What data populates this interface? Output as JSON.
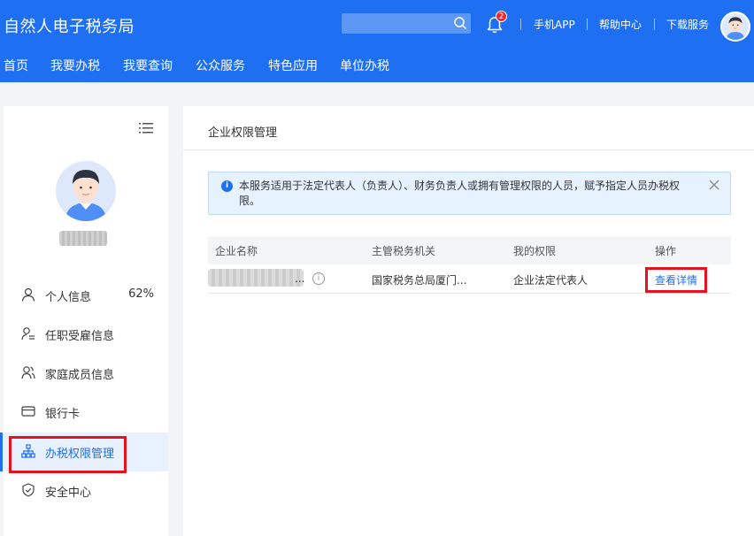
{
  "header": {
    "app_title": "自然人电子税务局",
    "search_placeholder": "",
    "notification_count": "2",
    "links": [
      "手机APP",
      "帮助中心",
      "下载服务"
    ]
  },
  "nav": [
    "首页",
    "我要办税",
    "我要查询",
    "公众服务",
    "特色应用",
    "单位办税"
  ],
  "sidebar": {
    "items": [
      {
        "label": "个人信息",
        "extra": "62%",
        "icon": "user-icon"
      },
      {
        "label": "任职受雇信息",
        "icon": "user-list-icon"
      },
      {
        "label": "家庭成员信息",
        "icon": "family-icon"
      },
      {
        "label": "银行卡",
        "icon": "card-icon"
      },
      {
        "label": "办税权限管理",
        "icon": "org-tree-icon",
        "active": true
      },
      {
        "label": "安全中心",
        "icon": "shield-icon"
      }
    ]
  },
  "main": {
    "title": "企业权限管理",
    "notice": "本服务适用于法定代表人（负责人）、财务负责人或拥有管理权限的人员，赋予指定人员办税权限。",
    "table": {
      "headers": [
        "企业名称",
        "主管税务机关",
        "我的权限",
        "操作"
      ],
      "rows": [
        {
          "company": "...",
          "tax_office": "国家税务总局厦门...",
          "permission": "企业法定代表人",
          "action": "查看详情"
        }
      ]
    }
  },
  "colors": {
    "primary": "#1f6ff2",
    "highlight": "#e5131d",
    "badge": "#f5222d"
  }
}
